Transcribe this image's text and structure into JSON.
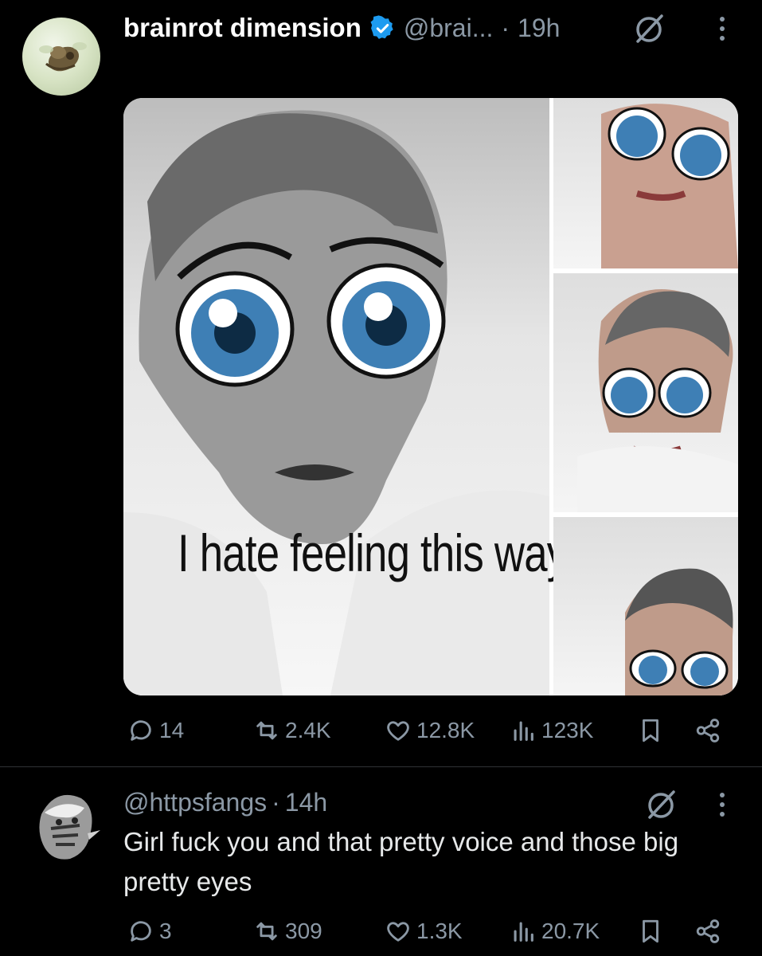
{
  "post": {
    "display_name": "brainrot dimension",
    "handle": "@brai...",
    "separator": "·",
    "time": "19h",
    "verified_icon": "verified-badge-icon",
    "image_caption": "I hate feeling this way",
    "stats": {
      "replies": "14",
      "reposts": "2.4K",
      "likes": "12.8K",
      "views": "123K"
    }
  },
  "reply": {
    "handle": "@httpsfangs",
    "separator": "·",
    "time": "14h",
    "text": "Girl fuck you and that pretty voice and those big pretty eyes",
    "stats": {
      "replies": "3",
      "reposts": "309",
      "likes": "1.3K",
      "views": "20.7K"
    }
  },
  "colors": {
    "background": "#000000",
    "text": "#e7e9ea",
    "muted": "#8b98a5",
    "verified": "#1d9bf0",
    "divider": "#2f3336"
  }
}
